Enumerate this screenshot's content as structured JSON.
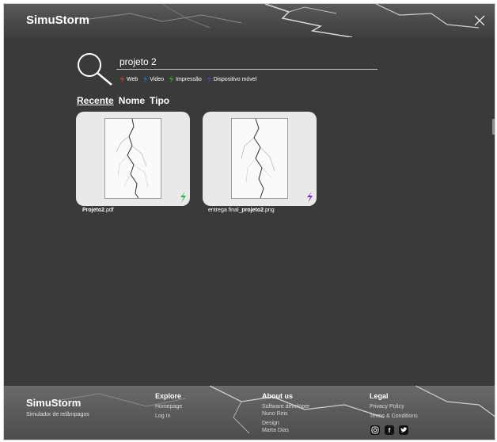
{
  "header": {
    "brand": "SimuStorm"
  },
  "search": {
    "value": "projeto 2",
    "placeholder": ""
  },
  "filters": [
    {
      "label": "Web",
      "color": "#e53935"
    },
    {
      "label": "Video",
      "color": "#2f6fe0"
    },
    {
      "label": "Impressão",
      "color": "#35b43a"
    },
    {
      "label": "Dispositivo móvel",
      "color": "#7b2fd6"
    }
  ],
  "sort_tabs": [
    "Recente",
    "Nome",
    "Tipo"
  ],
  "files": [
    {
      "name_bold": "Projeto2",
      "name_rest": ".pdf",
      "prefix": "",
      "badge_color": "#35b43a",
      "badge_icon": "lightning-icon"
    },
    {
      "prefix": "entrega final_",
      "name_bold": "projeto2",
      "name_rest": ".png",
      "badge_color": "#7b2fd6",
      "badge_icon": "lightning-icon"
    }
  ],
  "footer": {
    "brand": "SimuStorm",
    "tagline": "Simulador de relâmpagos",
    "explore": {
      "title": "Explore",
      "links": [
        "Homepage",
        "Log In"
      ]
    },
    "about": {
      "title": "About us",
      "software_label": "Software developer",
      "software_name": "Nuno Reis",
      "design_label": "Design",
      "design_name": "Marta Dias"
    },
    "legal": {
      "title": "Legal",
      "links": [
        "Privacy Policy",
        "Terms & Conditions"
      ]
    },
    "social": [
      "instagram-icon",
      "facebook-icon",
      "twitter-icon"
    ]
  }
}
